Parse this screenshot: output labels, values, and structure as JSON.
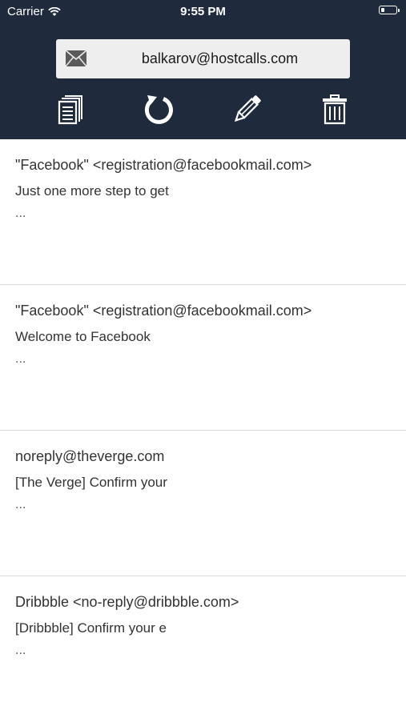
{
  "status_bar": {
    "carrier": "Carrier",
    "time": "9:55 PM",
    "battery_level": 0.25
  },
  "header": {
    "address_icon": "envelope-icon",
    "email_address": "balkarov@hostcalls.com",
    "toolbar": [
      {
        "icon": "copy-icon"
      },
      {
        "icon": "refresh-icon"
      },
      {
        "icon": "pencil-icon"
      },
      {
        "icon": "trash-icon"
      }
    ]
  },
  "colors": {
    "header_bg": "#1f2b3d",
    "address_bg": "#eeeeee",
    "text": "#333333",
    "divider": "#dcdcdc"
  },
  "messages": [
    {
      "from": "\"Facebook\" <registration@facebookmail.com>",
      "subject": "Just one more step to get",
      "preview": "..."
    },
    {
      "from": "\"Facebook\" <registration@facebookmail.com>",
      "subject": "Welcome to Facebook",
      "preview": "..."
    },
    {
      "from": "noreply@theverge.com",
      "subject": "[The Verge] Confirm your",
      "preview": "..."
    },
    {
      "from": "Dribbble <no-reply@dribbble.com>",
      "subject": "[Dribbble] Confirm your e",
      "preview": "..."
    }
  ]
}
